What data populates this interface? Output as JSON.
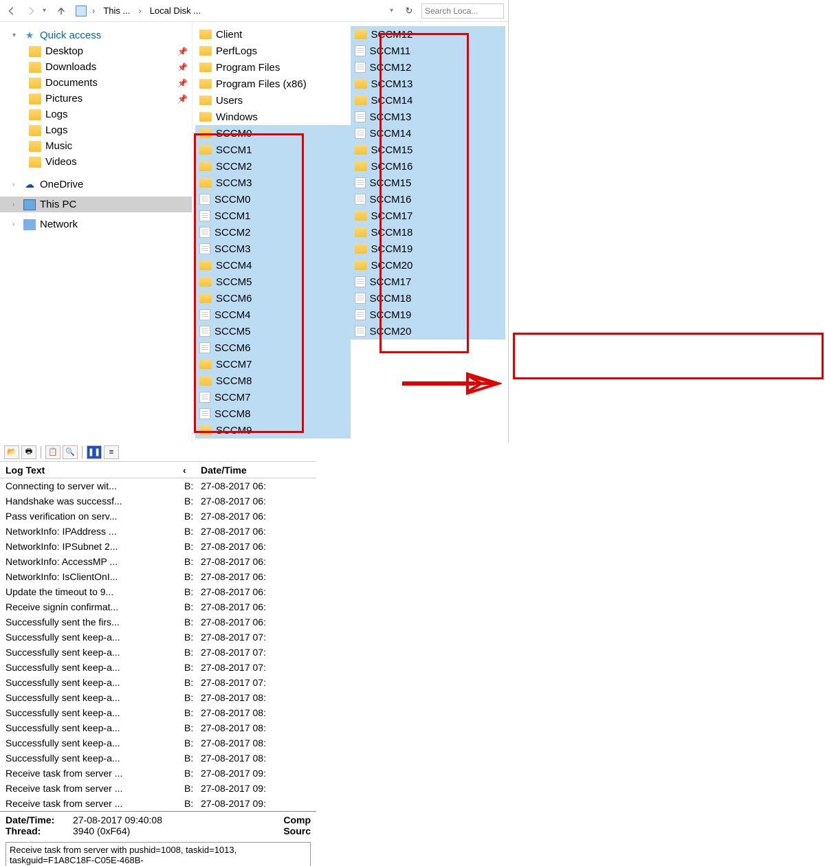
{
  "explorer": {
    "breadcrumb": {
      "item1": "This ...",
      "item2": "Local Disk ..."
    },
    "search_placeholder": "Search Loca...",
    "tree": {
      "quick_access": "Quick access",
      "desktop": "Desktop",
      "downloads": "Downloads",
      "documents": "Documents",
      "pictures": "Pictures",
      "logs1": "Logs",
      "logs2": "Logs",
      "music": "Music",
      "videos": "Videos",
      "onedrive": "OneDrive",
      "this_pc": "This PC",
      "network": "Network"
    },
    "col1": [
      {
        "t": "folder",
        "n": "Client"
      },
      {
        "t": "folder",
        "n": "PerfLogs"
      },
      {
        "t": "folder",
        "n": "Program Files"
      },
      {
        "t": "folder",
        "n": "Program Files (x86)"
      },
      {
        "t": "folder",
        "n": "Users"
      },
      {
        "t": "folder",
        "n": "Windows"
      },
      {
        "t": "folder",
        "n": "SCCM0",
        "s": true
      },
      {
        "t": "folder",
        "n": "SCCM1",
        "s": true
      },
      {
        "t": "folder",
        "n": "SCCM2",
        "s": true
      },
      {
        "t": "folder",
        "n": "SCCM3",
        "s": true
      },
      {
        "t": "file",
        "n": "SCCM0",
        "s": true
      },
      {
        "t": "file",
        "n": "SCCM1",
        "s": true
      },
      {
        "t": "file",
        "n": "SCCM2",
        "s": true
      },
      {
        "t": "file",
        "n": "SCCM3",
        "s": true
      },
      {
        "t": "folder",
        "n": "SCCM4",
        "s": true
      },
      {
        "t": "folder",
        "n": "SCCM5",
        "s": true
      },
      {
        "t": "folder",
        "n": "SCCM6",
        "s": true
      },
      {
        "t": "file",
        "n": "SCCM4",
        "s": true
      },
      {
        "t": "file",
        "n": "SCCM5",
        "s": true
      },
      {
        "t": "file",
        "n": "SCCM6",
        "s": true
      },
      {
        "t": "folder",
        "n": "SCCM7",
        "s": true
      },
      {
        "t": "folder",
        "n": "SCCM8",
        "s": true
      },
      {
        "t": "file",
        "n": "SCCM7",
        "s": true
      },
      {
        "t": "file",
        "n": "SCCM8",
        "s": true
      },
      {
        "t": "folder",
        "n": "SCCM9",
        "s": true
      }
    ],
    "col2": [
      {
        "t": "folder",
        "n": "SCCM12",
        "s": true
      },
      {
        "t": "file",
        "n": "SCCM11",
        "s": true
      },
      {
        "t": "file",
        "n": "SCCM12",
        "s": true
      },
      {
        "t": "folder",
        "n": "SCCM13",
        "s": true
      },
      {
        "t": "folder",
        "n": "SCCM14",
        "s": true
      },
      {
        "t": "file",
        "n": "SCCM13",
        "s": true
      },
      {
        "t": "file",
        "n": "SCCM14",
        "s": true
      },
      {
        "t": "folder",
        "n": "SCCM15",
        "s": true
      },
      {
        "t": "folder",
        "n": "SCCM16",
        "s": true
      },
      {
        "t": "file",
        "n": "SCCM15",
        "s": true
      },
      {
        "t": "file",
        "n": "SCCM16",
        "s": true
      },
      {
        "t": "folder",
        "n": "SCCM17",
        "s": true
      },
      {
        "t": "folder",
        "n": "SCCM18",
        "s": true
      },
      {
        "t": "folder",
        "n": "SCCM19",
        "s": true
      },
      {
        "t": "folder",
        "n": "SCCM20",
        "s": true
      },
      {
        "t": "file",
        "n": "SCCM17",
        "s": true
      },
      {
        "t": "file",
        "n": "SCCM18",
        "s": true
      },
      {
        "t": "file",
        "n": "SCCM19",
        "s": true
      },
      {
        "t": "file",
        "n": "SCCM20",
        "s": true
      }
    ]
  },
  "log": {
    "header": {
      "col1": "Log Text",
      "col3": "Date/Time"
    },
    "rows": [
      {
        "text": "Connecting to server wit...",
        "src": "B:",
        "date": "27-08-2017 06:"
      },
      {
        "text": "Handshake was successf...",
        "src": "B:",
        "date": "27-08-2017 06:"
      },
      {
        "text": "Pass verification on serv...",
        "src": "B:",
        "date": "27-08-2017 06:"
      },
      {
        "text": "NetworkInfo: IPAddress ...",
        "src": "B:",
        "date": "27-08-2017 06:"
      },
      {
        "text": "NetworkInfo: IPSubnet 2...",
        "src": "B:",
        "date": "27-08-2017 06:"
      },
      {
        "text": "NetworkInfo: AccessMP ...",
        "src": "B:",
        "date": "27-08-2017 06:"
      },
      {
        "text": "NetworkInfo: IsClientOnI...",
        "src": "B:",
        "date": "27-08-2017 06:"
      },
      {
        "text": "Update the timeout to 9...",
        "src": "B:",
        "date": "27-08-2017 06:"
      },
      {
        "text": "Receive signin confirmat...",
        "src": "B:",
        "date": "27-08-2017 06:"
      },
      {
        "text": "Successfully sent the firs...",
        "src": "B:",
        "date": "27-08-2017 06:"
      },
      {
        "text": "Successfully sent keep-a...",
        "src": "B:",
        "date": "27-08-2017 07:"
      },
      {
        "text": "Successfully sent keep-a...",
        "src": "B:",
        "date": "27-08-2017 07:"
      },
      {
        "text": "Successfully sent keep-a...",
        "src": "B:",
        "date": "27-08-2017 07:"
      },
      {
        "text": "Successfully sent keep-a...",
        "src": "B:",
        "date": "27-08-2017 07:"
      },
      {
        "text": "Successfully sent keep-a...",
        "src": "B:",
        "date": "27-08-2017 08:"
      },
      {
        "text": "Successfully sent keep-a...",
        "src": "B:",
        "date": "27-08-2017 08:"
      },
      {
        "text": "Successfully sent keep-a...",
        "src": "B:",
        "date": "27-08-2017 08:"
      },
      {
        "text": "Successfully sent keep-a...",
        "src": "B:",
        "date": "27-08-2017 08:"
      },
      {
        "text": "Successfully sent keep-a...",
        "src": "B:",
        "date": "27-08-2017 08:"
      },
      {
        "text": "Receive task from server ...",
        "src": "B:",
        "date": "27-08-2017 09:"
      },
      {
        "text": "Receive task from server ...",
        "src": "B:",
        "date": "27-08-2017 09:"
      },
      {
        "text": "Receive task from server ...",
        "src": "B:",
        "date": "27-08-2017 09:"
      }
    ],
    "detail": {
      "datetime_lbl": "Date/Time:",
      "datetime_val": "27-08-2017 09:40:08",
      "thread_lbl": "Thread:",
      "thread_val": "3940 (0xF64)",
      "comp": "Comp",
      "sourc": "Sourc",
      "msg": "Receive task from server with pushid=1008, taskid=1013, taskguid=F1A8C18F-C05E-468B-"
    }
  }
}
